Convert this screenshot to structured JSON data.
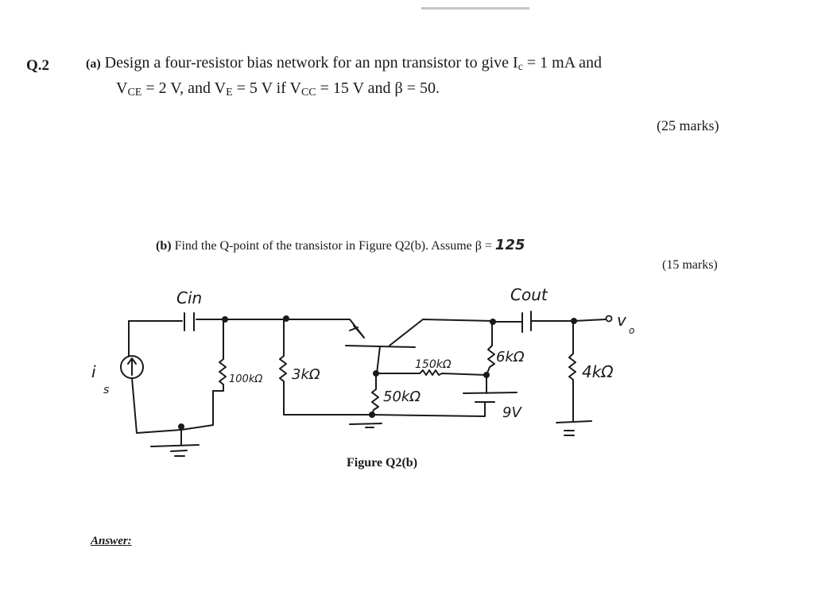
{
  "question": {
    "number": "Q.2",
    "part_a": {
      "label": "(a)",
      "line1": "Design a four-resistor bias network for an npn transistor to  give  I",
      "ic_sub": "c",
      "line1_end": " = 1 mA    and",
      "line2_v1": "V",
      "line2_sub1": "CE",
      "line2_t1": " = 2 V, and V",
      "line2_sub2": "E",
      "line2_t2": " = 5 V if V",
      "line2_sub3": "CC",
      "line2_t3": " = 15 V and β = 50.",
      "marks": "(25 marks)"
    },
    "part_b": {
      "label": "(b)",
      "text": "Find the Q-point of the transistor in Figure Q2(b). Assume β =",
      "beta_handwritten": "125",
      "marks": "(15 marks)"
    }
  },
  "figure": {
    "caption": "Figure Q2(b)",
    "components": {
      "source": "i_s",
      "source_label_main": "i",
      "source_label_sub": "s",
      "c_in": "Cin",
      "c_out": "Cout",
      "r1": "100kΩ",
      "r2": "3kΩ",
      "r3": "150kΩ",
      "r4": "50kΩ",
      "r5": "6kΩ",
      "r6": "4kΩ",
      "battery": "9V",
      "output": "v",
      "output_sub": "o"
    }
  },
  "answer_label": "Answer:"
}
